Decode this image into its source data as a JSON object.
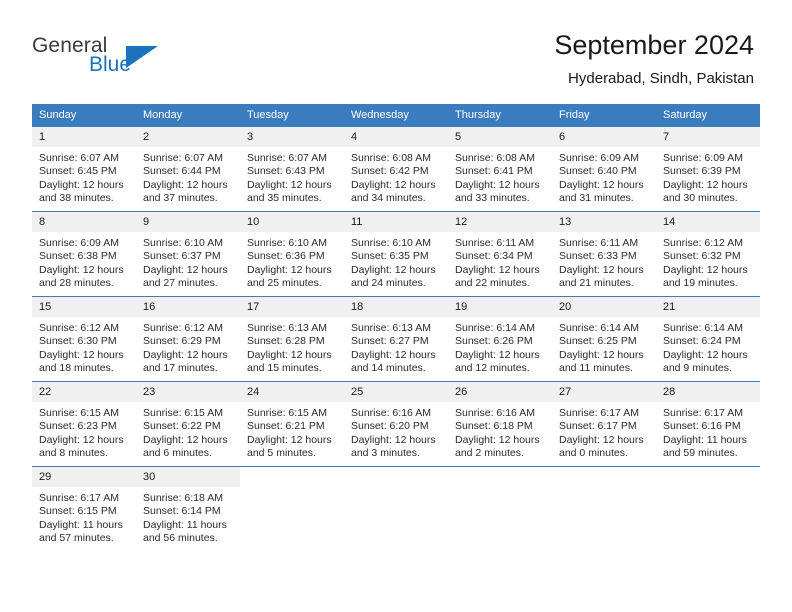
{
  "brand": {
    "name_part1": "General",
    "name_part2": "Blue",
    "logo_colors": {
      "text": "#3b3b3b",
      "accent": "#1b74bb"
    }
  },
  "header": {
    "title": "September 2024",
    "subtitle": "Hyderabad, Sindh, Pakistan"
  },
  "theme": {
    "header_row_bg": "#3b7cbf",
    "daynum_bg": "#f0f0f0",
    "row_border": "#3b7cbf"
  },
  "labels": {
    "sunrise_prefix": "Sunrise: ",
    "sunset_prefix": "Sunset: ",
    "daylight_prefix": "Daylight: "
  },
  "weekdays": [
    "Sunday",
    "Monday",
    "Tuesday",
    "Wednesday",
    "Thursday",
    "Friday",
    "Saturday"
  ],
  "weeks": [
    [
      {
        "day": "1",
        "sunrise": "Sunrise: 6:07 AM",
        "sunset": "Sunset: 6:45 PM",
        "daylight_line1": "Daylight: 12 hours",
        "daylight_line2": "and 38 minutes."
      },
      {
        "day": "2",
        "sunrise": "Sunrise: 6:07 AM",
        "sunset": "Sunset: 6:44 PM",
        "daylight_line1": "Daylight: 12 hours",
        "daylight_line2": "and 37 minutes."
      },
      {
        "day": "3",
        "sunrise": "Sunrise: 6:07 AM",
        "sunset": "Sunset: 6:43 PM",
        "daylight_line1": "Daylight: 12 hours",
        "daylight_line2": "and 35 minutes."
      },
      {
        "day": "4",
        "sunrise": "Sunrise: 6:08 AM",
        "sunset": "Sunset: 6:42 PM",
        "daylight_line1": "Daylight: 12 hours",
        "daylight_line2": "and 34 minutes."
      },
      {
        "day": "5",
        "sunrise": "Sunrise: 6:08 AM",
        "sunset": "Sunset: 6:41 PM",
        "daylight_line1": "Daylight: 12 hours",
        "daylight_line2": "and 33 minutes."
      },
      {
        "day": "6",
        "sunrise": "Sunrise: 6:09 AM",
        "sunset": "Sunset: 6:40 PM",
        "daylight_line1": "Daylight: 12 hours",
        "daylight_line2": "and 31 minutes."
      },
      {
        "day": "7",
        "sunrise": "Sunrise: 6:09 AM",
        "sunset": "Sunset: 6:39 PM",
        "daylight_line1": "Daylight: 12 hours",
        "daylight_line2": "and 30 minutes."
      }
    ],
    [
      {
        "day": "8",
        "sunrise": "Sunrise: 6:09 AM",
        "sunset": "Sunset: 6:38 PM",
        "daylight_line1": "Daylight: 12 hours",
        "daylight_line2": "and 28 minutes."
      },
      {
        "day": "9",
        "sunrise": "Sunrise: 6:10 AM",
        "sunset": "Sunset: 6:37 PM",
        "daylight_line1": "Daylight: 12 hours",
        "daylight_line2": "and 27 minutes."
      },
      {
        "day": "10",
        "sunrise": "Sunrise: 6:10 AM",
        "sunset": "Sunset: 6:36 PM",
        "daylight_line1": "Daylight: 12 hours",
        "daylight_line2": "and 25 minutes."
      },
      {
        "day": "11",
        "sunrise": "Sunrise: 6:10 AM",
        "sunset": "Sunset: 6:35 PM",
        "daylight_line1": "Daylight: 12 hours",
        "daylight_line2": "and 24 minutes."
      },
      {
        "day": "12",
        "sunrise": "Sunrise: 6:11 AM",
        "sunset": "Sunset: 6:34 PM",
        "daylight_line1": "Daylight: 12 hours",
        "daylight_line2": "and 22 minutes."
      },
      {
        "day": "13",
        "sunrise": "Sunrise: 6:11 AM",
        "sunset": "Sunset: 6:33 PM",
        "daylight_line1": "Daylight: 12 hours",
        "daylight_line2": "and 21 minutes."
      },
      {
        "day": "14",
        "sunrise": "Sunrise: 6:12 AM",
        "sunset": "Sunset: 6:32 PM",
        "daylight_line1": "Daylight: 12 hours",
        "daylight_line2": "and 19 minutes."
      }
    ],
    [
      {
        "day": "15",
        "sunrise": "Sunrise: 6:12 AM",
        "sunset": "Sunset: 6:30 PM",
        "daylight_line1": "Daylight: 12 hours",
        "daylight_line2": "and 18 minutes."
      },
      {
        "day": "16",
        "sunrise": "Sunrise: 6:12 AM",
        "sunset": "Sunset: 6:29 PM",
        "daylight_line1": "Daylight: 12 hours",
        "daylight_line2": "and 17 minutes."
      },
      {
        "day": "17",
        "sunrise": "Sunrise: 6:13 AM",
        "sunset": "Sunset: 6:28 PM",
        "daylight_line1": "Daylight: 12 hours",
        "daylight_line2": "and 15 minutes."
      },
      {
        "day": "18",
        "sunrise": "Sunrise: 6:13 AM",
        "sunset": "Sunset: 6:27 PM",
        "daylight_line1": "Daylight: 12 hours",
        "daylight_line2": "and 14 minutes."
      },
      {
        "day": "19",
        "sunrise": "Sunrise: 6:14 AM",
        "sunset": "Sunset: 6:26 PM",
        "daylight_line1": "Daylight: 12 hours",
        "daylight_line2": "and 12 minutes."
      },
      {
        "day": "20",
        "sunrise": "Sunrise: 6:14 AM",
        "sunset": "Sunset: 6:25 PM",
        "daylight_line1": "Daylight: 12 hours",
        "daylight_line2": "and 11 minutes."
      },
      {
        "day": "21",
        "sunrise": "Sunrise: 6:14 AM",
        "sunset": "Sunset: 6:24 PM",
        "daylight_line1": "Daylight: 12 hours",
        "daylight_line2": "and 9 minutes."
      }
    ],
    [
      {
        "day": "22",
        "sunrise": "Sunrise: 6:15 AM",
        "sunset": "Sunset: 6:23 PM",
        "daylight_line1": "Daylight: 12 hours",
        "daylight_line2": "and 8 minutes."
      },
      {
        "day": "23",
        "sunrise": "Sunrise: 6:15 AM",
        "sunset": "Sunset: 6:22 PM",
        "daylight_line1": "Daylight: 12 hours",
        "daylight_line2": "and 6 minutes."
      },
      {
        "day": "24",
        "sunrise": "Sunrise: 6:15 AM",
        "sunset": "Sunset: 6:21 PM",
        "daylight_line1": "Daylight: 12 hours",
        "daylight_line2": "and 5 minutes."
      },
      {
        "day": "25",
        "sunrise": "Sunrise: 6:16 AM",
        "sunset": "Sunset: 6:20 PM",
        "daylight_line1": "Daylight: 12 hours",
        "daylight_line2": "and 3 minutes."
      },
      {
        "day": "26",
        "sunrise": "Sunrise: 6:16 AM",
        "sunset": "Sunset: 6:18 PM",
        "daylight_line1": "Daylight: 12 hours",
        "daylight_line2": "and 2 minutes."
      },
      {
        "day": "27",
        "sunrise": "Sunrise: 6:17 AM",
        "sunset": "Sunset: 6:17 PM",
        "daylight_line1": "Daylight: 12 hours",
        "daylight_line2": "and 0 minutes."
      },
      {
        "day": "28",
        "sunrise": "Sunrise: 6:17 AM",
        "sunset": "Sunset: 6:16 PM",
        "daylight_line1": "Daylight: 11 hours",
        "daylight_line2": "and 59 minutes."
      }
    ],
    [
      {
        "day": "29",
        "sunrise": "Sunrise: 6:17 AM",
        "sunset": "Sunset: 6:15 PM",
        "daylight_line1": "Daylight: 11 hours",
        "daylight_line2": "and 57 minutes."
      },
      {
        "day": "30",
        "sunrise": "Sunrise: 6:18 AM",
        "sunset": "Sunset: 6:14 PM",
        "daylight_line1": "Daylight: 11 hours",
        "daylight_line2": "and 56 minutes."
      },
      {
        "day": "",
        "sunrise": "",
        "sunset": "",
        "daylight_line1": "",
        "daylight_line2": ""
      },
      {
        "day": "",
        "sunrise": "",
        "sunset": "",
        "daylight_line1": "",
        "daylight_line2": ""
      },
      {
        "day": "",
        "sunrise": "",
        "sunset": "",
        "daylight_line1": "",
        "daylight_line2": ""
      },
      {
        "day": "",
        "sunrise": "",
        "sunset": "",
        "daylight_line1": "",
        "daylight_line2": ""
      },
      {
        "day": "",
        "sunrise": "",
        "sunset": "",
        "daylight_line1": "",
        "daylight_line2": ""
      }
    ]
  ]
}
